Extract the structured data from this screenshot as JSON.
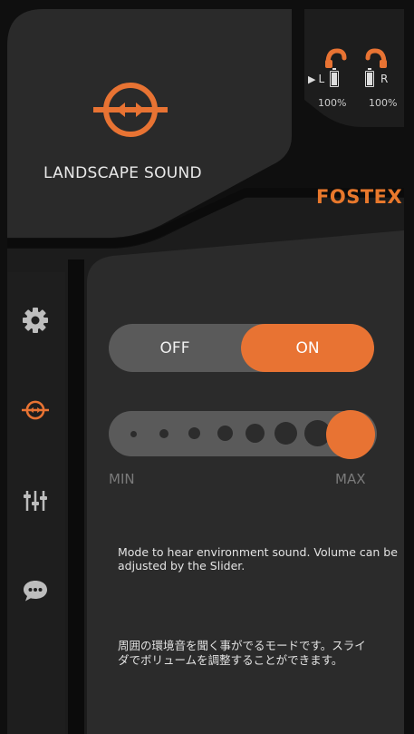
{
  "header": {
    "mode_title": "LANDSCAPE SOUND",
    "brand": "FOSTEX",
    "mode_icon": "landscape-sound-icon"
  },
  "battery": {
    "left_label": "L",
    "right_label": "R",
    "left_percent": "100%",
    "right_percent": "100%",
    "headphone_icon": "headphone-icon",
    "active_indicator": "play-triangle-icon"
  },
  "sidebar": {
    "items": [
      {
        "icon": "gear-icon",
        "active": false
      },
      {
        "icon": "landscape-sound-icon",
        "active": true
      },
      {
        "icon": "equalizer-icon",
        "active": false
      },
      {
        "icon": "chat-bubble-icon",
        "active": false
      }
    ]
  },
  "toggle": {
    "off_label": "OFF",
    "on_label": "ON",
    "state": "on"
  },
  "volume": {
    "min_label": "MIN",
    "max_label": "MAX",
    "level_fraction": 1.0
  },
  "descriptions": {
    "english": "Mode to hear environment sound. Volume can be adjusted by the Slider.",
    "japanese": "周囲の環境音を聞く事がでるモードです。スライダでボリュームを調整することができます。"
  },
  "colors": {
    "accent": "#e87333",
    "background": "#111111",
    "panel": "#262626",
    "control_track": "#5a5a5a"
  }
}
